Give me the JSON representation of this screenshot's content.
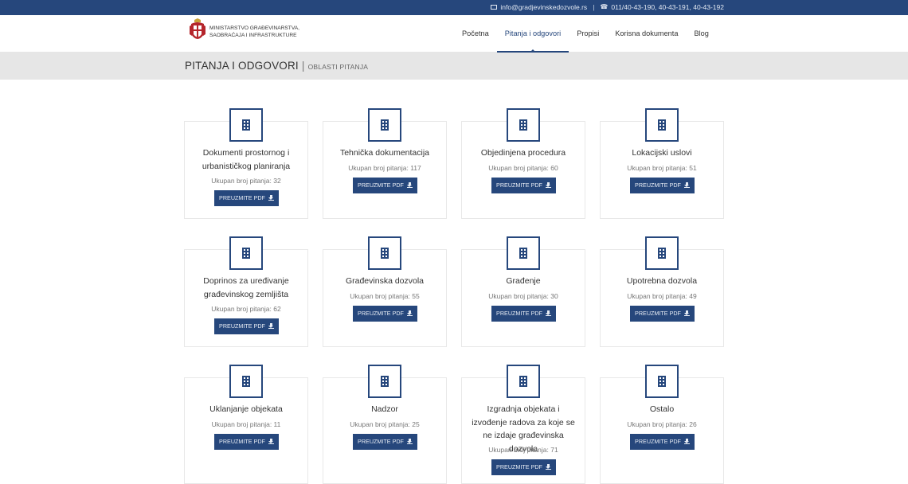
{
  "topbar": {
    "email": "info@gradjevinskedozvole.rs",
    "phones": "011/40-43-190, 40-43-191, 40-43-192"
  },
  "logo": {
    "line1": "MINISTARSTVO GRAĐEVINARSTVA,",
    "line2": "SAOBRAĆAJA I INFRASTRUKTURE"
  },
  "nav": [
    {
      "label": "Početna"
    },
    {
      "label": "Pitanja i odgovori"
    },
    {
      "label": "Propisi"
    },
    {
      "label": "Korisna dokumenta"
    },
    {
      "label": "Blog"
    }
  ],
  "page": {
    "title": "PITANJA I ODGOVORI",
    "separator": "|",
    "subtitle": "OBLASTI PITANJA"
  },
  "cards": [
    {
      "title": "Dokumenti prostornog i urbanističkog planiranja",
      "count": "Ukupan broj pitanja: 32",
      "button": "PREUZMITE PDF"
    },
    {
      "title": "Tehnička dokumentacija",
      "count": "Ukupan broj pitanja: 117",
      "button": "PREUZMITE PDF"
    },
    {
      "title": "Objedinjena procedura",
      "count": "Ukupan broj pitanja: 60",
      "button": "PREUZMITE PDF"
    },
    {
      "title": "Lokacijski uslovi",
      "count": "Ukupan broj pitanja: 51",
      "button": "PREUZMITE PDF"
    },
    {
      "title": "Doprinos za uređivanje građevinskog zemljišta",
      "count": "Ukupan broj pitanja: 62",
      "button": "PREUZMITE PDF"
    },
    {
      "title": "Građevinska dozvola",
      "count": "Ukupan broj pitanja: 55",
      "button": "PREUZMITE PDF"
    },
    {
      "title": "Građenje",
      "count": "Ukupan broj pitanja: 30",
      "button": "PREUZMITE PDF"
    },
    {
      "title": "Upotrebna dozvola",
      "count": "Ukupan broj pitanja: 49",
      "button": "PREUZMITE PDF"
    },
    {
      "title": "Uklanjanje objekata",
      "count": "Ukupan broj pitanja: 11",
      "button": "PREUZMITE PDF"
    },
    {
      "title": "Nadzor",
      "count": "Ukupan broj pitanja: 25",
      "button": "PREUZMITE PDF"
    },
    {
      "title": "Izgradnja objekata i izvođenje radova za koje se ne izdaje građevinska dozvola",
      "count": "Ukupan broj pitanja: 71",
      "button": "PREUZMITE PDF"
    },
    {
      "title": "Ostalo",
      "count": "Ukupan broj pitanja: 26",
      "button": "PREUZMITE PDF"
    }
  ],
  "colors": {
    "primary": "#26477c",
    "titlebar_bg": "#e6e6e6"
  }
}
